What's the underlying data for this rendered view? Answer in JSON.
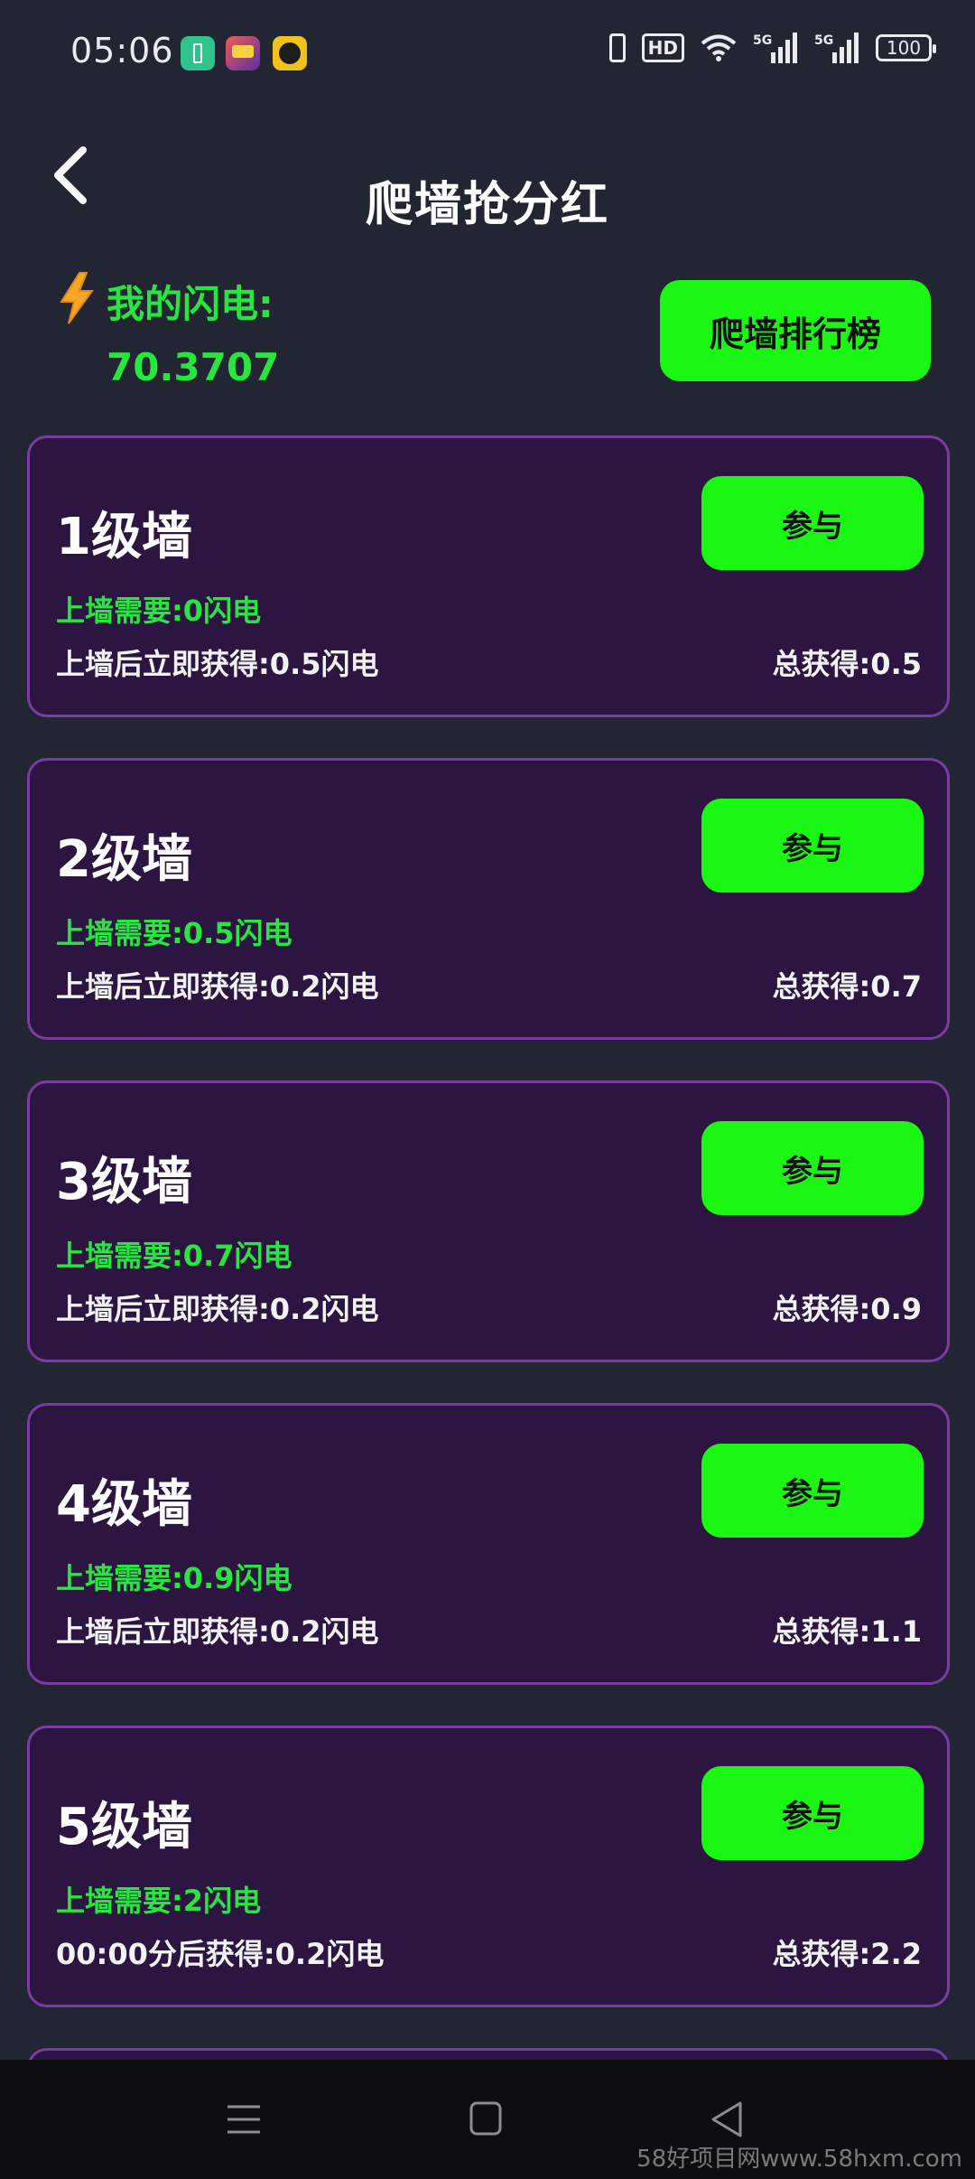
{
  "status_bar": {
    "time": "05:06",
    "hd_label": "HD",
    "network_1": "5G",
    "network_2": "5G",
    "battery": "100",
    "icons": [
      "battery-app-icon",
      "game-app-icon",
      "video-app-icon",
      "vibrate-icon",
      "hd-icon",
      "wifi-icon",
      "signal-icon",
      "battery-icon"
    ]
  },
  "header": {
    "back_icon": "chevron-left-icon",
    "title": "爬墙抢分红"
  },
  "balance": {
    "icon": "lightning-icon",
    "label": "我的闪电:",
    "value": "70.3707"
  },
  "rank_button": {
    "label": "爬墙排行榜"
  },
  "walls": [
    {
      "title": "1级墙",
      "button": "参与",
      "requirement": "上墙需要:0闪电",
      "gain": "上墙后立即获得:0.5闪电",
      "total": "总获得:0.5"
    },
    {
      "title": "2级墙",
      "button": "参与",
      "requirement": "上墙需要:0.5闪电",
      "gain": "上墙后立即获得:0.2闪电",
      "total": "总获得:0.7"
    },
    {
      "title": "3级墙",
      "button": "参与",
      "requirement": "上墙需要:0.7闪电",
      "gain": "上墙后立即获得:0.2闪电",
      "total": "总获得:0.9"
    },
    {
      "title": "4级墙",
      "button": "参与",
      "requirement": "上墙需要:0.9闪电",
      "gain": "上墙后立即获得:0.2闪电",
      "total": "总获得:1.1"
    },
    {
      "title": "5级墙",
      "button": "参与",
      "requirement": "上墙需要:2闪电",
      "gain": "00:00分后获得:0.2闪电",
      "total": "总获得:2.2"
    }
  ],
  "nav_bar": {
    "icons": [
      "menu-icon",
      "home-icon",
      "back-icon"
    ]
  },
  "watermark": "58好项目网www.58hxm.com",
  "colors": {
    "background": "#222632",
    "card_background": "#2c1540",
    "card_border": "#7c3aa4",
    "accent_green": "#19f712",
    "text_green": "#28e640"
  }
}
